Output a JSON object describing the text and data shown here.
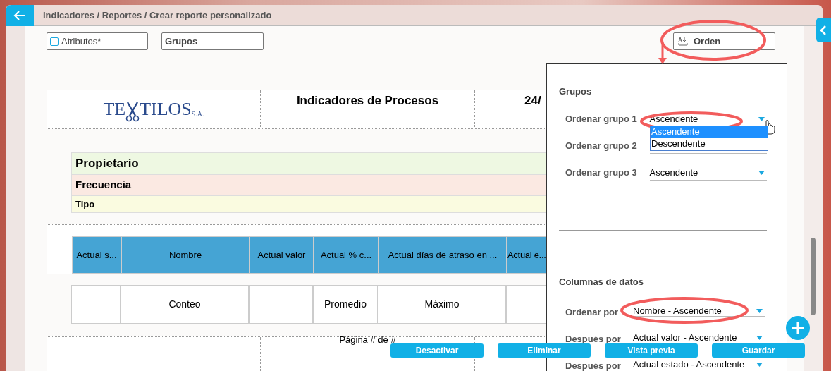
{
  "breadcrumb": "Indicadores / Reportes / Crear reporte personalizado",
  "toolbar": [
    {
      "label": "Atributos*",
      "kind": "checkbox",
      "checked": false
    },
    {
      "label": "Grupos",
      "kind": "plain"
    },
    {
      "label": "Orden",
      "kind": "sort"
    }
  ],
  "report": {
    "logo": {
      "parts": [
        "TE",
        "TILOS"
      ],
      "suffix": "S.A."
    },
    "title": "Indicadores de Procesos",
    "date": "24/",
    "groups": [
      {
        "label": "Propietario",
        "color": "#eef8e2"
      },
      {
        "label": "Frecuencia",
        "color": "#fbe9e2"
      },
      {
        "label": "Tipo",
        "color": "#fafbe0"
      }
    ],
    "columns": [
      "Actual s...",
      "Nombre",
      "Actual valor",
      "Actual % c...",
      "Actual días de atraso en ...",
      "Actual e..."
    ],
    "totals": [
      {
        "kind": "blank"
      },
      {
        "kind": "text",
        "text": "Conteo"
      },
      {
        "kind": "blank"
      },
      {
        "kind": "text",
        "text": "Promedio"
      },
      {
        "kind": "text",
        "text": "Máximo"
      },
      {
        "kind": "blank"
      }
    ],
    "footer": "Página # de #"
  },
  "order_panel": {
    "groups_title": "Grupos",
    "group_rows": [
      {
        "label": "Ordenar grupo 1",
        "value": "Ascendente",
        "open": true,
        "options": [
          {
            "label": "Ascendente",
            "selected": true
          },
          {
            "label": "Descendente",
            "selected": false
          }
        ]
      },
      {
        "label": "Ordenar grupo 2",
        "open": false
      },
      {
        "label": "Ordenar grupo 3",
        "value": "Ascendente",
        "open": false
      }
    ],
    "columns_title": "Columnas de datos",
    "column_rows": [
      {
        "label": "Ordenar por",
        "value": "Nombre - Ascendente"
      },
      {
        "label": "Después por",
        "value": "Actual valor - Ascendente"
      },
      {
        "label": "Después por",
        "value": "Actual estado - Ascendente"
      }
    ]
  },
  "actions": [
    "Desactivar",
    "Eliminar",
    "Vista previa",
    "Guardar"
  ]
}
